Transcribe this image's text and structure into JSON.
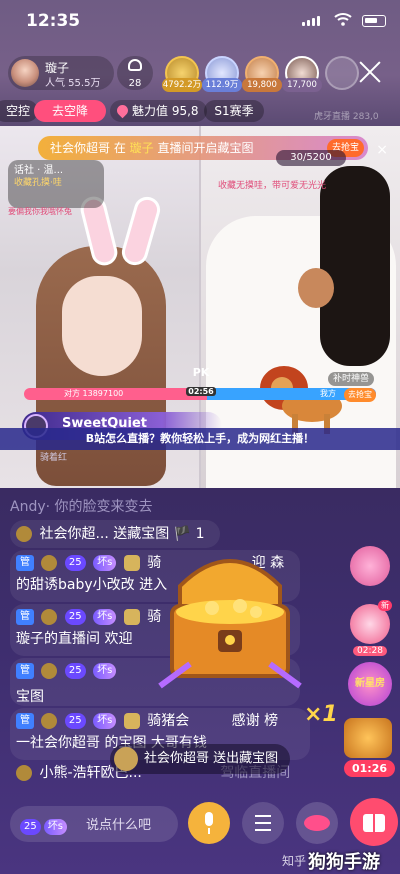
{
  "status": {
    "time": "12:35"
  },
  "header": {
    "host_name": "璇子",
    "popularity": "人气 55.5万",
    "viewer_count": "28",
    "rank_scores": [
      "4792.2万",
      "112.9万",
      "19,800",
      "17,700"
    ]
  },
  "tags": {
    "kongwei": "空控",
    "go_kongwei": "去空降",
    "charm": "魅力值 95,8",
    "season": "S1赛季",
    "faint": "虎牙直播 283,0"
  },
  "video": {
    "mission_prefix": "社会你超哥 在",
    "mission_highlight": "璇子",
    "mission_suffix": "直播间开启藏宝图",
    "mission_grab": "去抢宝",
    "left_hint": "话社 · 温...",
    "left_hint_small": "收藏孔摸·哇",
    "left_sub": "要偏我你我哦怀兔",
    "score_bar": "30/5200",
    "right_sub": "收藏无摸哇，带可爱无光光",
    "pk_label": "PK",
    "pk_time": "02:56",
    "pk_left": "对方 13897100",
    "pk_right": "我方",
    "anchor": "补时神兽",
    "grab2": "去抢宝",
    "sweet_name": "SweetQuiet",
    "banner": "B站怎么直播？教你轻松上手，成为网红主播！",
    "under_text": "骑着红"
  },
  "chat": {
    "msg0": "Andy· 你的脸变来变去",
    "msg1_name": "社会你超...",
    "msg1_text": "送藏宝图",
    "msg1_count": "1",
    "msg2_name": "骑",
    "msg2_line1_tail": "迎 森",
    "msg2_line2": "的甜诱baby小改改 进入",
    "msg3_name": "骑",
    "msg3_line1_tail": "来到",
    "msg3_line2": "璇子的直播间 欢迎",
    "msg4_line": "宝图",
    "msg5_name": "骑猪会",
    "msg5_tail": "感谢 榜",
    "msg5_line2": "一社会你超哥 的宝图 大哥有钱",
    "msg6": "小熊-浩轩欧巴...",
    "msg6_tail": "驾临直播间",
    "badge_guan": "管",
    "badge_level": "25",
    "badge_bad": "坏s",
    "toast": "社会你超哥 送出藏宝图"
  },
  "overlay": {
    "multiplier": "×1"
  },
  "side": {
    "new_badge": "新",
    "date": "02:28",
    "new_house": "新星房",
    "timer": "01:26"
  },
  "bottom": {
    "level": "25",
    "bad": "坏s",
    "placeholder": "说点什么吧"
  },
  "watermark": {
    "zhihu": "知乎 @",
    "site": "狗狗手游"
  }
}
